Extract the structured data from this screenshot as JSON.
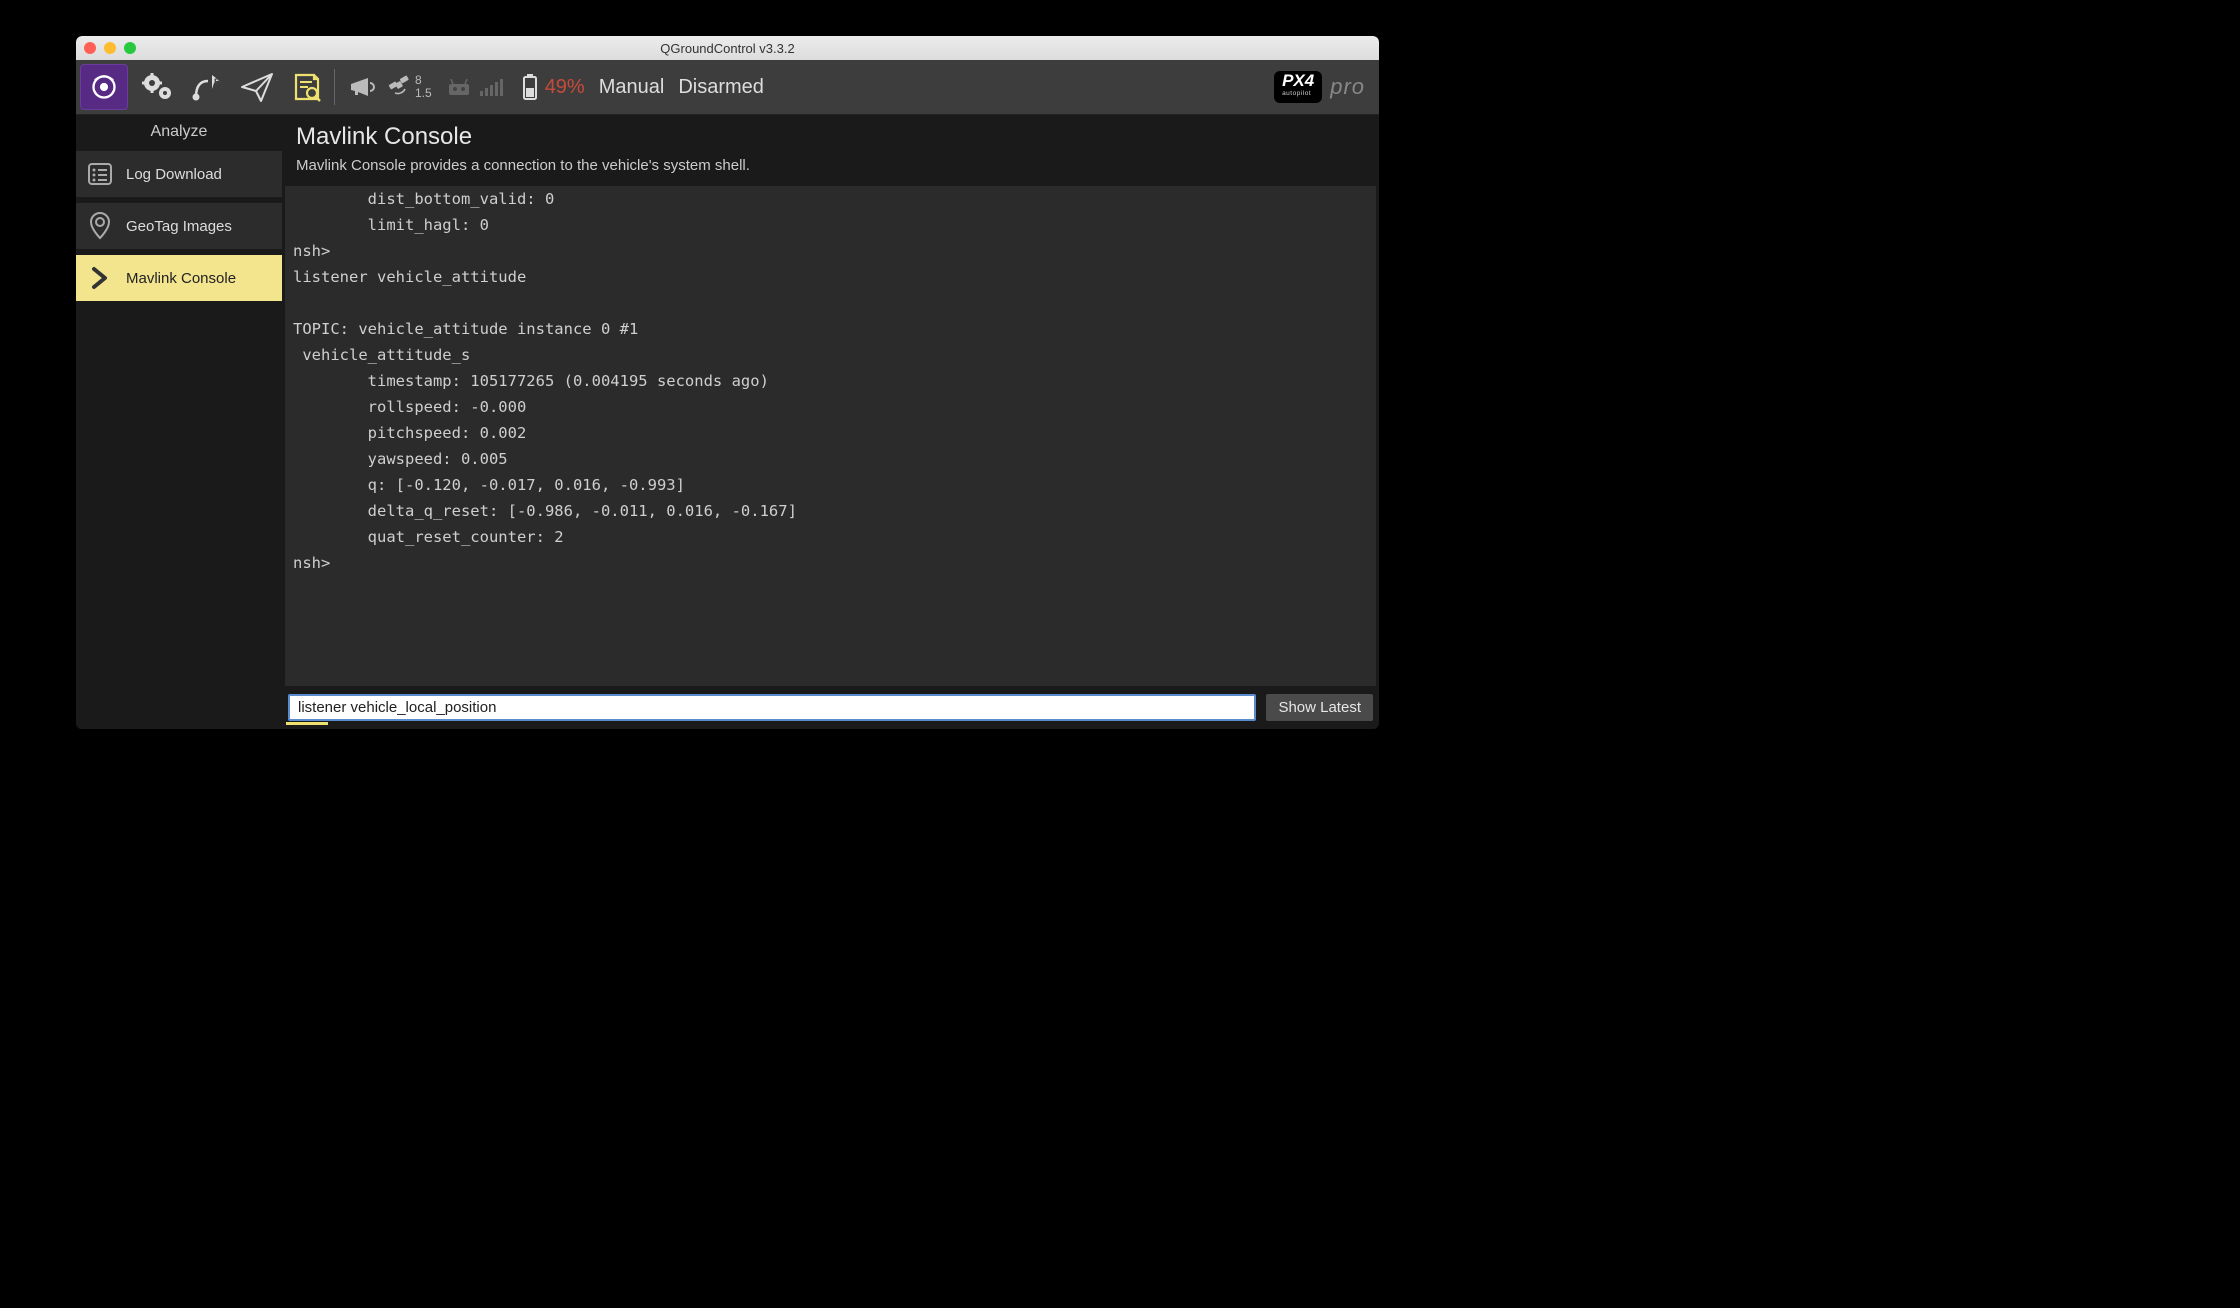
{
  "window": {
    "title": "QGroundControl v3.3.2"
  },
  "toolbar": {
    "gps": {
      "sats": "8",
      "hdop": "1.5"
    },
    "battery": {
      "percent": "49%"
    },
    "mode": "Manual",
    "armed": "Disarmed",
    "brand_pro": "pro"
  },
  "sidebar": {
    "title": "Analyze",
    "items": [
      {
        "label": "Log Download"
      },
      {
        "label": "GeoTag Images"
      },
      {
        "label": "Mavlink Console"
      }
    ]
  },
  "main": {
    "title": "Mavlink Console",
    "subtitle": "Mavlink Console provides a connection to the vehicle's system shell."
  },
  "console": {
    "text": "        dist_bottom_valid: 0\n        limit_hagl: 0\nnsh>\nlistener vehicle_attitude\n\nTOPIC: vehicle_attitude instance 0 #1\n vehicle_attitude_s\n        timestamp: 105177265 (0.004195 seconds ago)\n        rollspeed: -0.000\n        pitchspeed: 0.002\n        yawspeed: 0.005\n        q: [-0.120, -0.017, 0.016, -0.993]\n        delta_q_reset: [-0.986, -0.011, 0.016, -0.167]\n        quat_reset_counter: 2\nnsh>"
  },
  "input": {
    "value": "listener vehicle_local_position",
    "button": "Show Latest"
  }
}
